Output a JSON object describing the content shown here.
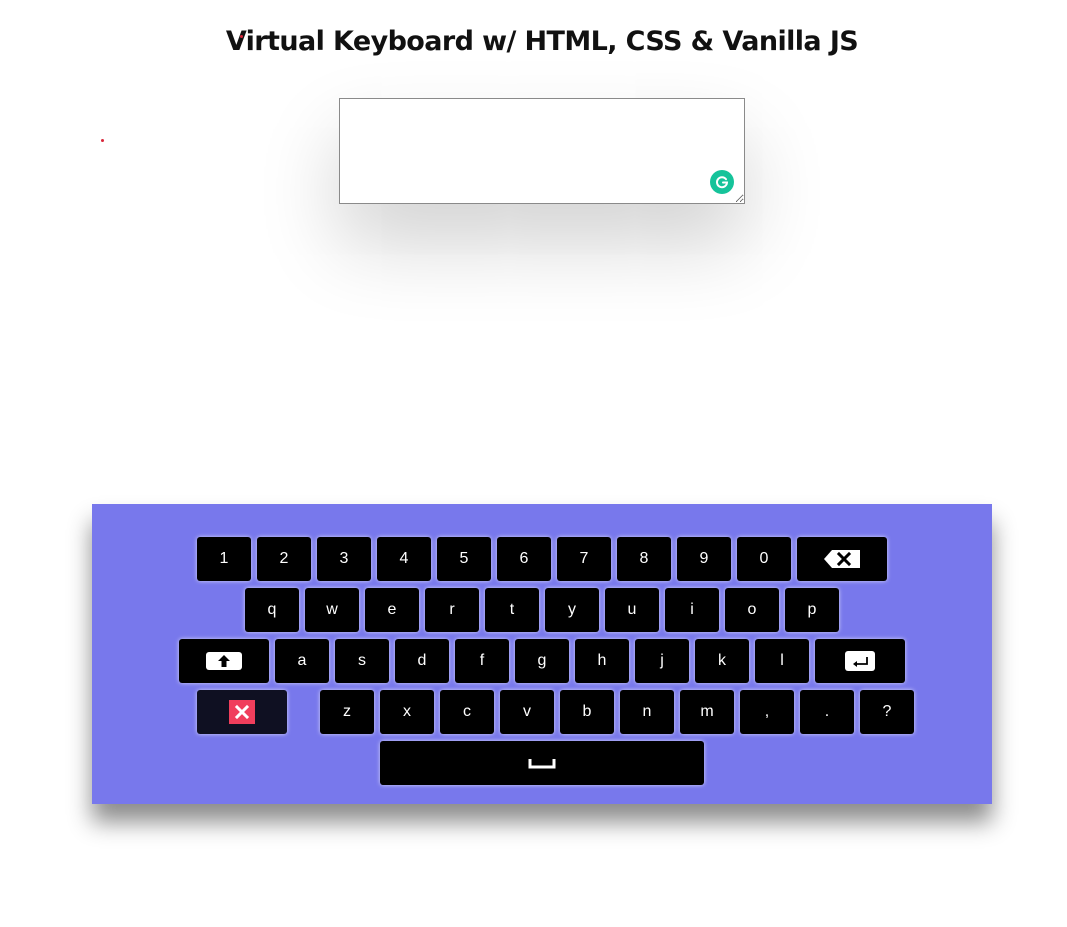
{
  "title": "Virtual Keyboard w/ HTML, CSS & Vanilla JS",
  "textarea": {
    "value": "",
    "placeholder": ""
  },
  "keyboard": {
    "background": "#7878ec",
    "key_color": "#000000",
    "close_icon_color": "#f03e5c",
    "rows": [
      [
        "1",
        "2",
        "3",
        "4",
        "5",
        "6",
        "7",
        "8",
        "9",
        "0"
      ],
      [
        "q",
        "w",
        "e",
        "r",
        "t",
        "y",
        "u",
        "i",
        "o",
        "p"
      ],
      [
        "a",
        "s",
        "d",
        "f",
        "g",
        "h",
        "j",
        "k",
        "l"
      ],
      [
        "z",
        "x",
        "c",
        "v",
        "b",
        "n",
        "m",
        ",",
        ".",
        "?"
      ]
    ],
    "special_keys": {
      "backspace": "backspace-icon",
      "caps": "caps-lock-icon",
      "enter": "enter-icon",
      "close": "close-icon",
      "space": "space-icon"
    }
  }
}
